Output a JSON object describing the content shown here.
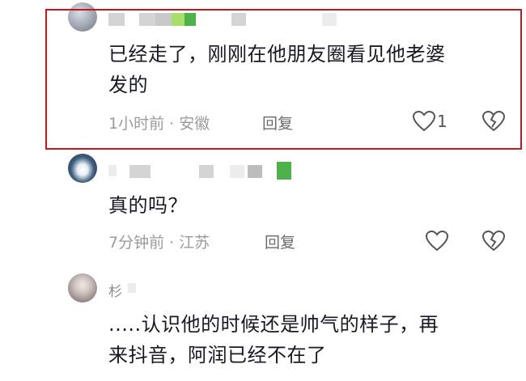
{
  "comments": [
    {
      "name_visible": "",
      "text_lines": [
        "已经走了，刚刚在他朋友圈看见他老婆",
        "发的"
      ],
      "time_location": "1小时前 · 安徽",
      "reply_label": "回复",
      "like_count": "1"
    },
    {
      "name_visible": "",
      "text_lines": [
        "真的吗？"
      ],
      "time_location": "7分钟前 · 江苏",
      "reply_label": "回复",
      "like_count": ""
    },
    {
      "name_visible": "杉",
      "text_lines": [
        ".....认识他的时候还是帅气的样子，再",
        "来抖音，阿润已经不在了"
      ],
      "time_location": "",
      "reply_label": "",
      "like_count": ""
    }
  ],
  "icons": {
    "like": "heart-outline-icon",
    "dislike": "broken-heart-icon"
  },
  "colors": {
    "highlight_border": "#c4161c",
    "text": "#161823",
    "meta": "#9b9b9b"
  }
}
